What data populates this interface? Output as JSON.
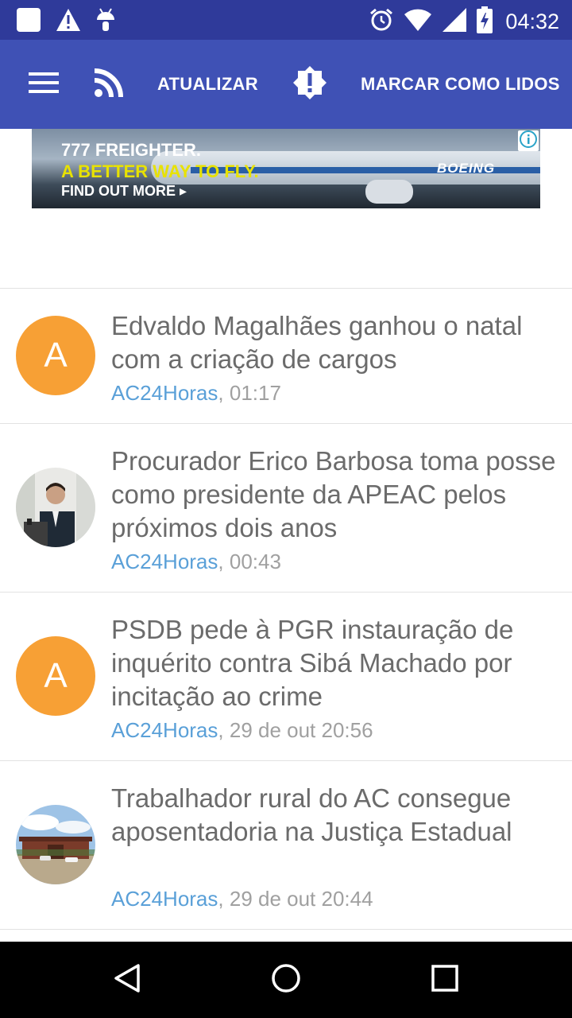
{
  "status_bar": {
    "time": "04:32",
    "left_icons": [
      "notification-square-icon",
      "warning-icon",
      "android-icon"
    ],
    "right_icons": [
      "alarm-icon",
      "wifi-icon",
      "signal-icon",
      "battery-charging-icon"
    ]
  },
  "app_bar": {
    "color": "#3f51b5",
    "menu_icon": "menu-icon",
    "rss_icon": "rss-icon",
    "refresh_label": "ATUALIZAR",
    "alert_icon": "alert-badge-icon",
    "mark_read_label": "MARCAR COMO LIDOS"
  },
  "ad": {
    "line1": "777 FREIGHTER.",
    "line2": "A BETTER WAY TO FLY.",
    "line3": "FIND OUT MORE ▸",
    "brand": "BOEING",
    "info_icon": "info-icon"
  },
  "news": [
    {
      "avatar_type": "letter",
      "avatar_letter": "A",
      "headline": "Edvaldo Magalhães ganhou o natal com a criação de cargos",
      "source": "AC24Horas",
      "time": ", 01:17"
    },
    {
      "avatar_type": "photo",
      "avatar_letter": "",
      "headline": "Procurador Erico Barbosa toma posse como presidente da APEAC pelos próximos dois anos",
      "source": "AC24Horas",
      "time": ", 00:43"
    },
    {
      "avatar_type": "letter",
      "avatar_letter": "A",
      "headline": "PSDB pede à PGR instauração de inquérito contra Sibá Machado por incitação ao crime",
      "source": "AC24Horas",
      "time": ", 29 de out 20:56"
    },
    {
      "avatar_type": "photo",
      "avatar_letter": "",
      "headline": "Trabalhador rural do AC consegue aposentadoria na Justiça Estadual",
      "source": "AC24Horas",
      "time": ", 29 de out 20:44"
    }
  ],
  "nav_bar": {
    "back_icon": "back-triangle-icon",
    "home_icon": "home-circle-icon",
    "recents_icon": "recents-square-icon"
  }
}
